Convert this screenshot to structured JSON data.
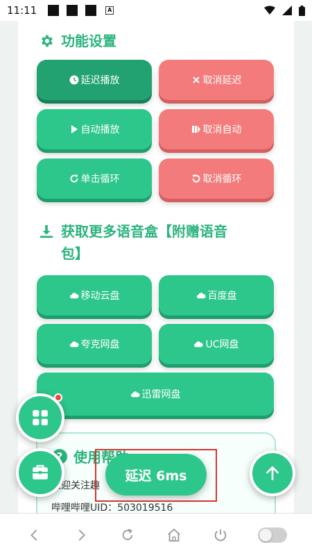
{
  "status_bar": {
    "time": "11:11",
    "notif_a": "A"
  },
  "sections": {
    "function_settings": {
      "title": "功能设置"
    },
    "get_voice": {
      "title_line1": "获取更多语音盒【附赠语音",
      "title_line2": "包】"
    },
    "help": {
      "title": "使用帮助",
      "line1": "欢迎关注趣",
      "line2": "哔哩哔哩UID：503019516"
    }
  },
  "buttons": {
    "delay_play": "延迟播放",
    "cancel_delay": "取消延迟",
    "auto_play": "自动播放",
    "cancel_auto": "取消自动",
    "single_loop": "单击循环",
    "cancel_loop": "取消循环",
    "mobile_cloud": "移动云盘",
    "baidu": "百度盘",
    "quark": "夸克网盘",
    "uc": "UC网盘",
    "xunlei": "迅雷网盘"
  },
  "delay_indicator": "延迟 6ms",
  "colors": {
    "accent": "#2dc68b",
    "danger": "#f37b7b",
    "pressed": "#22a271"
  },
  "icons": {
    "settings": "gear-icon",
    "download": "download-icon",
    "help": "help-circle-icon",
    "grid": "grid-icon",
    "toolbox": "toolbox-icon",
    "scroll_top": "arrow-up-icon"
  }
}
